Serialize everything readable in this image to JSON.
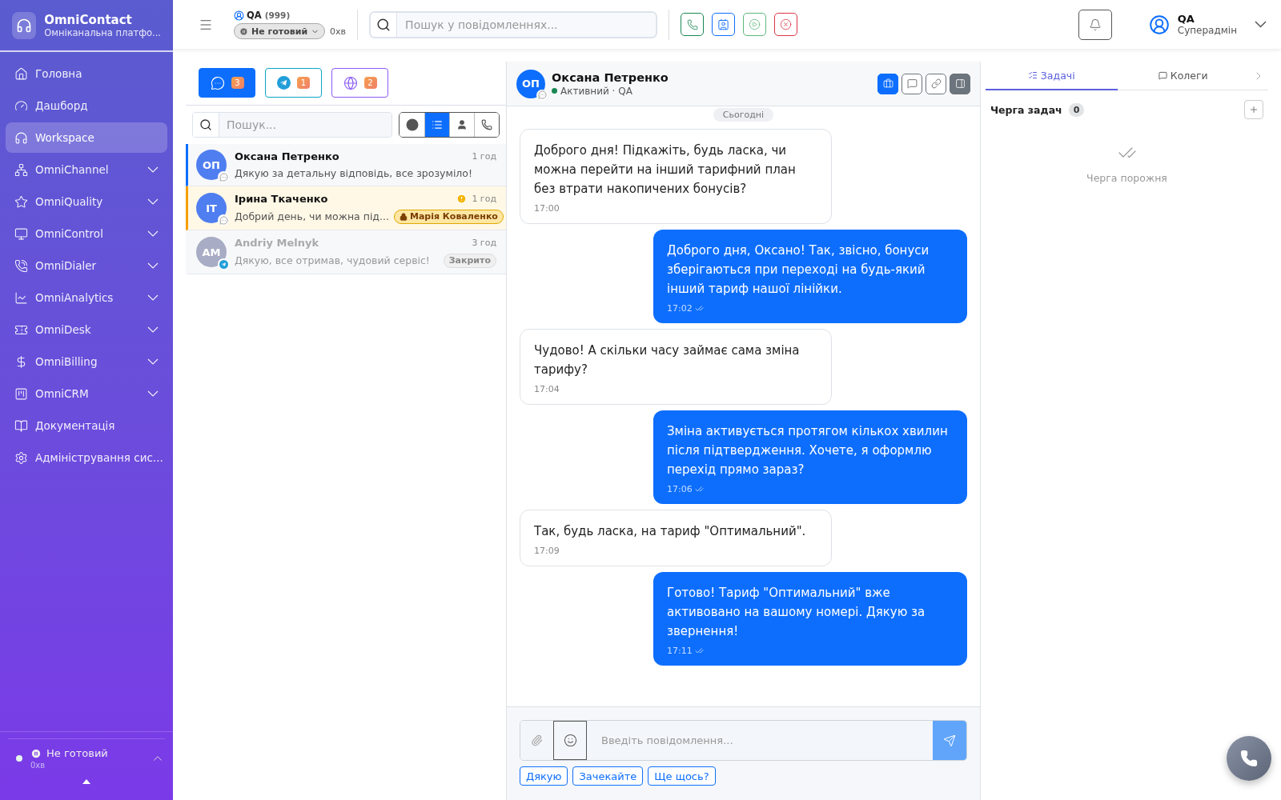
{
  "sidebar": {
    "brand": {
      "title": "OmniContact",
      "subtitle": "Омніканальна платфо..."
    },
    "items": [
      {
        "label": "Головна",
        "selected": false,
        "expandable": false
      },
      {
        "label": "Дашборд",
        "selected": false,
        "expandable": false
      },
      {
        "label": "Workspace",
        "selected": true,
        "expandable": false
      },
      {
        "label": "OmniChannel",
        "selected": false,
        "expandable": true
      },
      {
        "label": "OmniQuality",
        "selected": false,
        "expandable": true
      },
      {
        "label": "OmniControl",
        "selected": false,
        "expandable": true
      },
      {
        "label": "OmniDialer",
        "selected": false,
        "expandable": true
      },
      {
        "label": "OmniAnalytics",
        "selected": false,
        "expandable": true
      },
      {
        "label": "OmniDesk",
        "selected": false,
        "expandable": true
      },
      {
        "label": "OmniBilling",
        "selected": false,
        "expandable": true
      },
      {
        "label": "OmniCRM",
        "selected": false,
        "expandable": true
      },
      {
        "label": "Документація",
        "selected": false,
        "expandable": false
      },
      {
        "label": "Адміністрування сис...",
        "selected": false,
        "expandable": false
      }
    ],
    "status": {
      "label": "Не готовий",
      "time": "0хв"
    }
  },
  "header": {
    "agent": {
      "name": "QA",
      "count": "(999)"
    },
    "status": {
      "label": "Не готовий",
      "time": "0хв"
    },
    "search": {
      "placeholder": "Пошук у повідомленнях..."
    },
    "user": {
      "name": "QA",
      "role": "Суперадмін"
    }
  },
  "channels": [
    {
      "count": "3",
      "selected": true
    },
    {
      "count": "1",
      "selected": false
    },
    {
      "count": "2",
      "selected": false
    }
  ],
  "list_search": {
    "placeholder": "Пошук..."
  },
  "filters": [
    {
      "selected": false
    },
    {
      "selected": true
    },
    {
      "selected": false
    },
    {
      "selected": false
    }
  ],
  "conversations": [
    {
      "initials": "ОП",
      "name": "Оксана Петренко",
      "time": "1 год",
      "preview": "Дякую за детальну відповідь, все зрозуміло!",
      "selected": true,
      "pending": false,
      "closed": false,
      "alert": false
    },
    {
      "initials": "ІТ",
      "name": "Ірина Ткаченко",
      "time": "1 год",
      "preview": "Добрий день, чи можна під...",
      "selected": false,
      "pending": true,
      "closed": false,
      "alert": true,
      "tag": {
        "kind": "assignee",
        "label": "Марія Коваленко"
      }
    },
    {
      "initials": "AM",
      "name": "Andriy Melnyk",
      "time": "3 год",
      "preview": "Дякую, все отримав, чудовий сервіс!",
      "selected": false,
      "pending": false,
      "closed": true,
      "alert": false,
      "tag": {
        "kind": "status",
        "label": "Закрито"
      }
    }
  ],
  "chat": {
    "contact": {
      "initials": "ОП",
      "name": "Оксана Петренко",
      "status": "Активний · QA"
    },
    "date_label": "Сьогодні",
    "messages": [
      {
        "kind": "incoming",
        "text": "Доброго дня! Підкажіть, будь ласка, чи можна перейти на інший тарифний план без втрати накопичених бонусів?",
        "time": "17:00",
        "read": false
      },
      {
        "kind": "outgoing",
        "text": "Доброго дня, Оксано! Так, звісно, бонуси зберігаються при переході на будь-який інший тариф нашої лінійки.",
        "time": "17:02",
        "read": true
      },
      {
        "kind": "incoming",
        "text": "Чудово! А скільки часу займає сама зміна тарифу?",
        "time": "17:04",
        "read": false
      },
      {
        "kind": "outgoing",
        "text": "Зміна активується протягом кількох хвилин після підтвердження. Хочете, я оформлю перехід прямо зараз?",
        "time": "17:06",
        "read": true
      },
      {
        "kind": "incoming",
        "text": "Так, будь ласка, на тариф \"Оптимальний\".",
        "time": "17:09",
        "read": false
      },
      {
        "kind": "outgoing",
        "text": "Готово! Тариф \"Оптимальний\" вже активовано на вашому номері. Дякую за звернення!",
        "time": "17:11",
        "read": true
      }
    ],
    "composer": {
      "placeholder": "Введіть повідомлення..."
    },
    "quick_replies": [
      "Дякую",
      "Зачекайте",
      "Ще щось?"
    ]
  },
  "side_panel": {
    "tabs": [
      {
        "label": "Задачі",
        "selected": true
      },
      {
        "label": "Колеги",
        "selected": false
      }
    ],
    "queue": {
      "title": "Черга задач",
      "count": "0",
      "empty_text": "Черга порожня"
    }
  }
}
